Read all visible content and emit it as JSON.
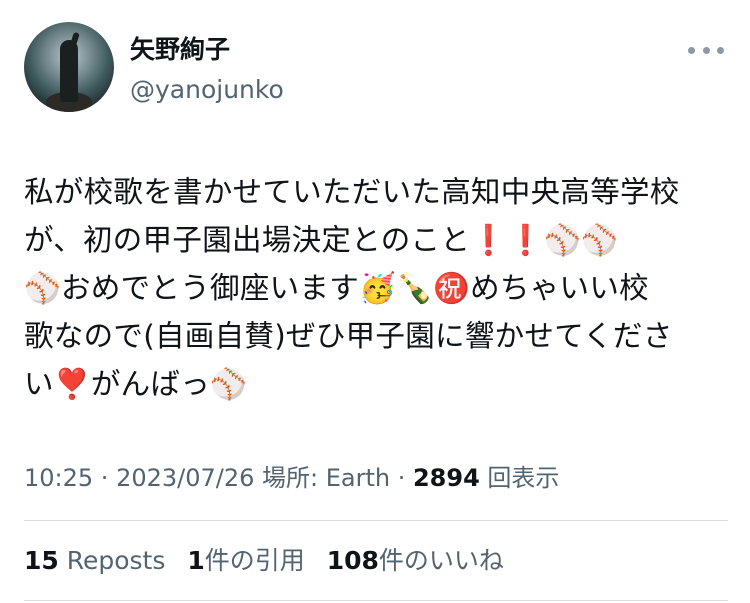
{
  "user": {
    "display_name": "矢野絢子",
    "handle": "@yanojunko"
  },
  "tweet": {
    "lines": [
      "私が校歌を書かせていただいた高知中央高等学校",
      "が、初の甲子園出場決定とのこと❗️❗️⚾️⚾️",
      "⚾️おめでとう御座います🥳🍾㊗️めちゃいい校",
      "歌なので(自画自賛)ぜひ甲子園に響かせてくださ",
      "い❣️がんばっ⚾️"
    ]
  },
  "meta": {
    "time": "10:25",
    "sep1": " · ",
    "date": "2023/07/26",
    "place_label": " 場所: ",
    "place": "Earth",
    "sep2": " · ",
    "views_count": "2894",
    "views_label": " 回表示"
  },
  "stats": {
    "reposts_count": "15",
    "reposts_label": " Reposts",
    "quotes_count": "1",
    "quotes_label": "件の引用",
    "likes_count": "108",
    "likes_label": "件のいいね"
  },
  "icons": {
    "more": "more-horizontal-icon"
  }
}
